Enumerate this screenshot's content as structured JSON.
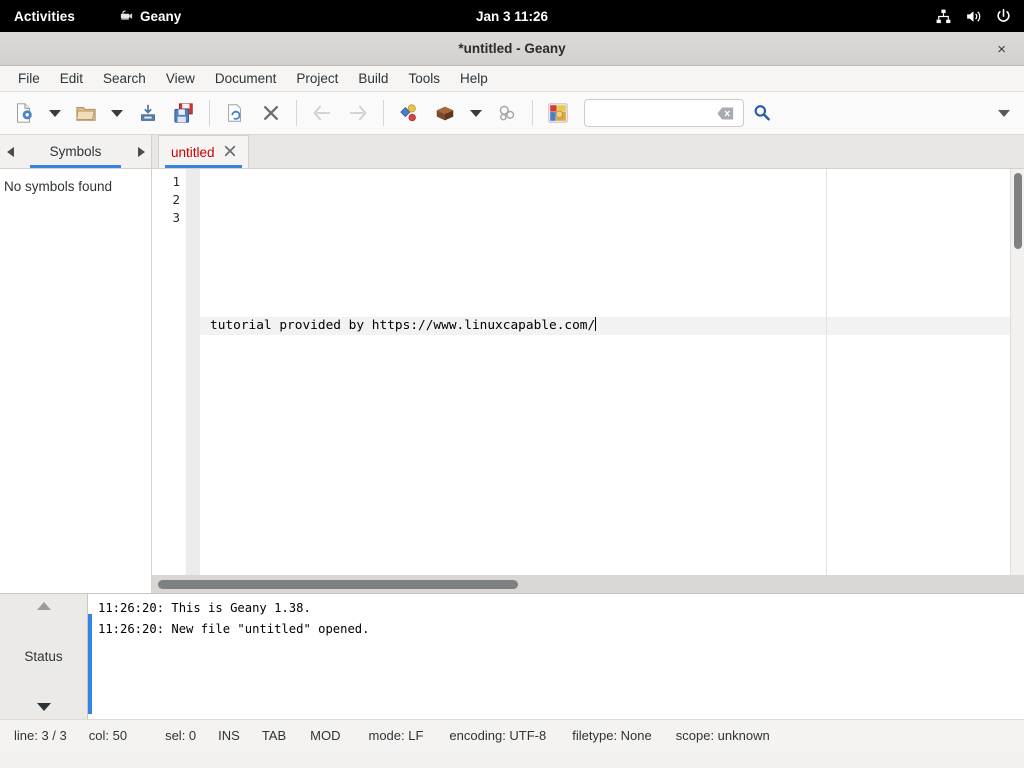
{
  "topbar": {
    "activities": "Activities",
    "app_name": "Geany",
    "app_icon": "geany-lamp-icon",
    "clock": "Jan 3  11:26",
    "tray": [
      {
        "name": "network-icon"
      },
      {
        "name": "volume-icon"
      },
      {
        "name": "power-icon"
      }
    ]
  },
  "window": {
    "title": "*untitled - Geany",
    "close_label": "×"
  },
  "menubar": {
    "items": [
      {
        "label": "File"
      },
      {
        "label": "Edit"
      },
      {
        "label": "Search"
      },
      {
        "label": "View"
      },
      {
        "label": "Document"
      },
      {
        "label": "Project"
      },
      {
        "label": "Build"
      },
      {
        "label": "Tools"
      },
      {
        "label": "Help"
      }
    ]
  },
  "toolbar": {
    "buttons": [
      {
        "name": "new-file-button",
        "icon": "new-document-icon"
      },
      {
        "name": "new-file-menu-button",
        "icon": "chevron-down-icon"
      },
      {
        "name": "open-file-button",
        "icon": "open-folder-icon"
      },
      {
        "name": "open-recent-menu-button",
        "icon": "chevron-down-icon"
      },
      {
        "name": "save-button",
        "icon": "save-floppy-icon"
      },
      {
        "name": "save-all-button",
        "icon": "save-all-icon"
      },
      {
        "name": "reload-button",
        "icon": "reload-icon"
      },
      {
        "name": "close-document-button",
        "icon": "close-x-icon"
      },
      {
        "name": "navigate-back-button",
        "icon": "arrow-back-icon"
      },
      {
        "name": "navigate-forward-button",
        "icon": "arrow-forward-icon"
      },
      {
        "name": "compile-button",
        "icon": "compile-icon"
      },
      {
        "name": "build-button",
        "icon": "build-brick-icon"
      },
      {
        "name": "build-menu-button",
        "icon": "chevron-down-icon"
      },
      {
        "name": "run-button",
        "icon": "run-gears-icon"
      },
      {
        "name": "color-chooser-button",
        "icon": "color-palette-icon"
      }
    ],
    "search": {
      "value": "",
      "placeholder": "",
      "clear_icon": "clear-backspace-icon",
      "find_icon": "search-magnifier-icon"
    },
    "overflow_icon": "chevron-down-icon"
  },
  "sidebar": {
    "tab_label": "Symbols",
    "prev_icon": "chevron-left-icon",
    "next_icon": "chevron-right-icon",
    "empty_message": "No symbols found"
  },
  "editor": {
    "document_tab": {
      "label": "untitled",
      "close_icon": "close-x-icon",
      "modified": true
    },
    "line_numbers": [
      "1",
      "2",
      "3"
    ],
    "lines": [
      "",
      "",
      "tutorial provided by https://www.linuxcapable.com/"
    ],
    "active_line_index": 2
  },
  "message_window": {
    "tab_label": "Status",
    "scroll_up_icon": "triangle-up-icon",
    "scroll_down_icon": "triangle-down-icon",
    "messages": [
      "11:26:20: This is Geany 1.38.",
      "11:26:20: New file \"untitled\" opened."
    ]
  },
  "statusbar": {
    "items": [
      {
        "name": "status-line",
        "text": "line: 3 / 3"
      },
      {
        "name": "status-col",
        "text": "col: 50"
      },
      {
        "name": "status-sel",
        "text": "sel: 0"
      },
      {
        "name": "status-insert-mode",
        "text": "INS"
      },
      {
        "name": "status-indent-mode",
        "text": "TAB"
      },
      {
        "name": "status-modified",
        "text": "MOD"
      },
      {
        "name": "status-eol-mode",
        "text": "mode: LF"
      },
      {
        "name": "status-encoding",
        "text": "encoding: UTF-8"
      },
      {
        "name": "status-filetype",
        "text": "filetype: None"
      },
      {
        "name": "status-scope",
        "text": "scope: unknown"
      }
    ]
  },
  "colors": {
    "accent_blue": "#3584e4",
    "modified_red": "#cc0000",
    "topbar_bg": "#000000",
    "titlebar_bg": "#d6d3d0",
    "toolbar_bg": "#fbfafa",
    "margin_line": "#d6ead6"
  }
}
